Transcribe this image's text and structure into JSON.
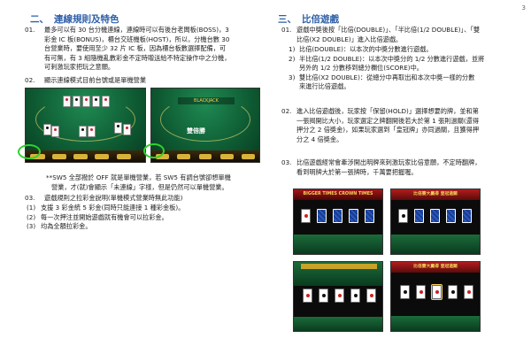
{
  "page_number": "3",
  "left": {
    "section_number": "二、",
    "section_title": "連線規則及特色",
    "item01_marker": "01.",
    "item01_lines": [
      "最多可以有 30 台分機連線，連線時可以有後台老闆板(BOSS)，3",
      "彩金 IC 板(BONUS)，櫃台交班機板(HOST)，所以，分機台數 30",
      "台營業時，要使用至少 32 片 IC 板，因為櫃台板數選擇配備，可",
      "有可無，有 3 組隨機亂數彩金不定時贈送給不特定操作中之分機，",
      "可刺激玩家把玩之意願。"
    ],
    "item02_marker": "02.",
    "item02_line": "顯示連線模式目前台號或是單機營業",
    "note_lines": [
      "**SW5 全部撥於 OFF 就是單機營業，若 SW5 有調台號卻想單機",
      "營業，才(就)會顯示「未連線」字樣，但是仍然可以單機營業。"
    ],
    "item03_marker": "03.",
    "item03_line": "遊戲規則之拉彩金說明(單機模式營業時無此功能)",
    "subitems": [
      {
        "marker": "(1)",
        "text": "支援 3 彩金統 5 彩金(同時只能連接 1 種彩金板)。"
      },
      {
        "marker": "(2)",
        "text": "每一次押注並開始遊戲就有機會可以拉彩金。"
      },
      {
        "marker": "(3)",
        "text": "均為全額拉彩金。"
      }
    ],
    "screenshot2_text": "雙倍勝"
  },
  "right": {
    "section_number": "三、",
    "section_title": "比倍遊戲",
    "item01_marker": "01.",
    "item01_lines": [
      "遊戲中獎後按「比倍(DOUBLE)」、「半比倍(1/2 DOUBLE)」、「雙",
      "比倍(X2 DOUBLE)」進入比倍遊戲。"
    ],
    "subitems": [
      {
        "marker": "1)",
        "lines": [
          "比倍(DOUBLE)：以本次的中獎分數進行遊戲。"
        ]
      },
      {
        "marker": "2)",
        "lines": [
          "半比倍(1/2 DOUBLE)：以本次中獎分的 1/2 分數進行遊戲，並將",
          "另外的 1/2 分數移到總分欄位(SCORE)中。"
        ]
      },
      {
        "marker": "3)",
        "lines": [
          "雙比倍(X2 DOUBLE)：從總分中再取出和本次中獎一樣的分數",
          "來進行比倍遊戲。"
        ]
      }
    ],
    "item02_marker": "02.",
    "item02_lines": [
      "進入比倍遊戲後，玩家按「保留(HOLD)」選擇想要的牌，並和第",
      "一張揭開比大小，玩家選定之牌翻開後若大於第 1 張則過關(還得",
      "押分之 2 倍獎金)，如果玩家選到「皇冠牌」亦同過關，且獲得押",
      "分之 4 倍獎金。"
    ],
    "item03_marker": "03.",
    "item03_lines": [
      "比倍遊戲經常會牽涉開出明牌來刺激玩家比倍意願，不定時翻牌，",
      "看到明牌大於第一張牌時，千萬要把握喔。"
    ],
    "banners": {
      "bigger_times": "BIGGER TIMES",
      "crown_times": "CROWN TIMES",
      "red_banner": "比倍賽大贏得 皇冠過關",
      "red_banner2": "比倍賽大贏得 皇冠過關"
    }
  },
  "colors": {
    "title": "#2e5fa8",
    "highlight_circle": "#2fd12f"
  }
}
